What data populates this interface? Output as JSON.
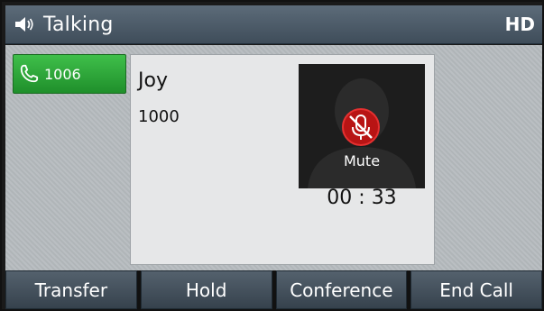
{
  "header": {
    "title": "Talking",
    "badge": "HD",
    "status_icon": "speaker-icon"
  },
  "line": {
    "label": "1006",
    "icon": "phone-icon",
    "color": "#2aa536"
  },
  "call": {
    "name": "Joy",
    "number": "1000",
    "mute_label": "Mute",
    "mute_icon": "microphone-muted-icon",
    "duration": "00 : 33"
  },
  "softkeys": [
    {
      "label": "Transfer"
    },
    {
      "label": "Hold"
    },
    {
      "label": "Conference"
    },
    {
      "label": "End Call"
    }
  ]
}
